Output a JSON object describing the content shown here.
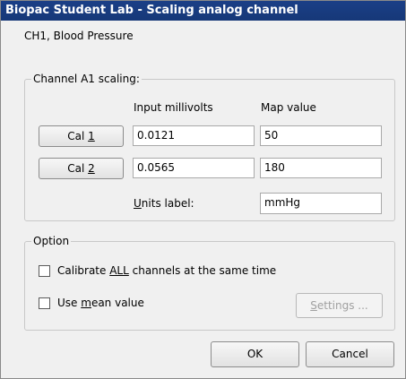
{
  "window": {
    "title": "Biopac Student Lab - Scaling analog channel"
  },
  "channel_name": "CH1, Blood Pressure",
  "scaling_group": {
    "title": "Channel A1 scaling:",
    "col_input": "Input millivolts",
    "col_map": "Map value",
    "cal1": {
      "label_prefix": "Cal ",
      "label_key": "1",
      "input_mv": "0.0121",
      "map_value": "50"
    },
    "cal2": {
      "label_prefix": "Cal ",
      "label_key": "2",
      "input_mv": "0.0565",
      "map_value": "180"
    },
    "units_label_key": "U",
    "units_label_rest": "nits label:",
    "units_value": "mmHg"
  },
  "option_group": {
    "title": "Option",
    "calibrate_all": {
      "pre": "Calibrate ",
      "key": "ALL",
      "post": " channels at the same time",
      "checked": false
    },
    "use_mean": {
      "pre": "Use ",
      "key": "m",
      "post": "ean value",
      "checked": false
    },
    "settings": {
      "key": "S",
      "rest": "ettings ...",
      "enabled": false
    }
  },
  "footer": {
    "ok_label": "OK",
    "cancel_label": "Cancel"
  }
}
